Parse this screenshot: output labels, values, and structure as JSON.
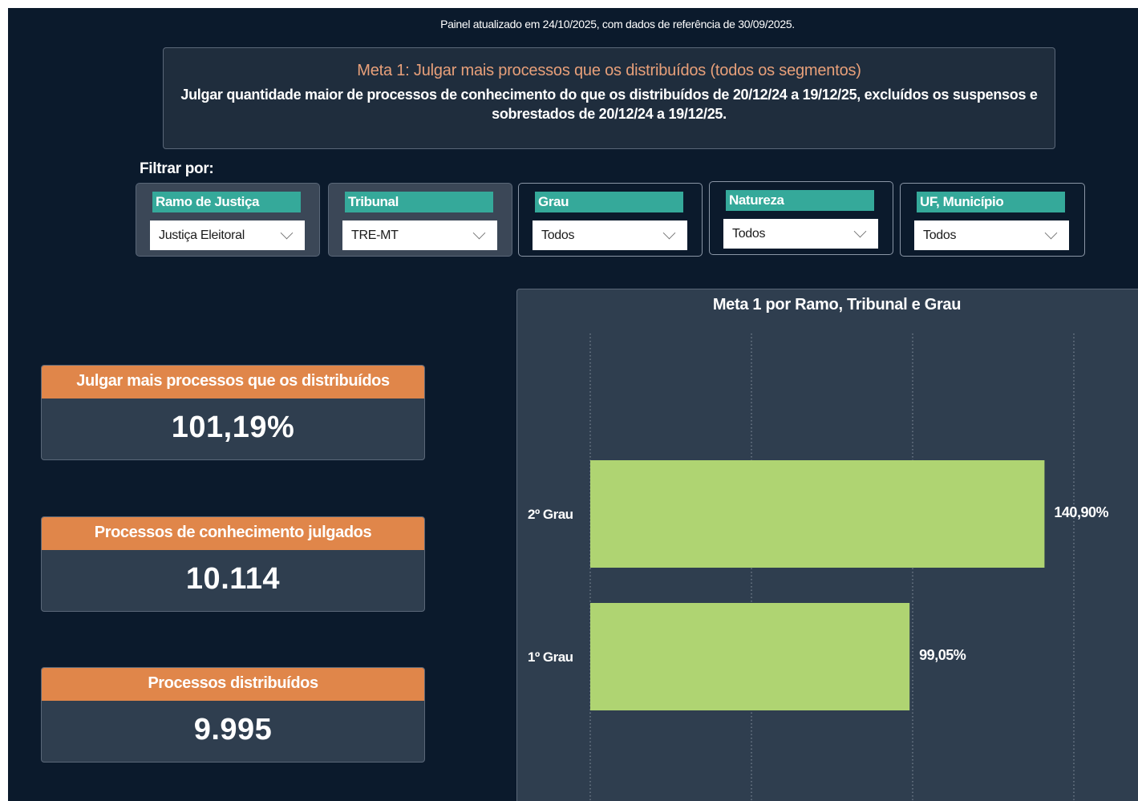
{
  "header": {
    "update_note": "Painel atualizado em 24/10/2025, com dados de referência de 30/09/2025."
  },
  "goal": {
    "title": "Meta 1: Julgar mais processos que os distribuídos (todos os segmentos)",
    "description": "Julgar quantidade maior de processos de conhecimento do que os distribuídos de 20/12/24 a 19/12/25, excluídos os suspensos e sobrestados de 20/12/24 a 19/12/25."
  },
  "filters": {
    "label": "Filtrar por:",
    "slicers": [
      {
        "title": "Ramo de Justiça",
        "value": "Justiça Eleitoral"
      },
      {
        "title": "Tribunal",
        "value": "TRE-MT"
      },
      {
        "title": "Grau",
        "value": "Todos"
      },
      {
        "title": "Natureza",
        "value": "Todos"
      },
      {
        "title": "UF, Município",
        "value": "Todos"
      }
    ]
  },
  "kpis": [
    {
      "label": "Julgar mais processos que os distribuídos",
      "value": "101,19%"
    },
    {
      "label": "Processos de conhecimento julgados",
      "value": "10.114"
    },
    {
      "label": "Processos distribuídos",
      "value": "9.995"
    }
  ],
  "colors": {
    "background": "#0b1a2c",
    "panel": "#2f3e4f",
    "accent_orange": "#e0864a",
    "accent_teal": "#35a99a",
    "bar": "#afd472",
    "goal_title": "#e8a07a"
  },
  "chart_data": {
    "type": "bar",
    "orientation": "horizontal",
    "title": "Meta 1 por Ramo, Tribunal e Grau",
    "categories": [
      "2º Grau",
      "1º Grau"
    ],
    "values": [
      140.9,
      99.05
    ],
    "value_labels": [
      "140,90%",
      "99,05%"
    ],
    "xlim": [
      0,
      150
    ],
    "gridlines": [
      0,
      50,
      100,
      150
    ],
    "grid": true,
    "legend": false
  }
}
